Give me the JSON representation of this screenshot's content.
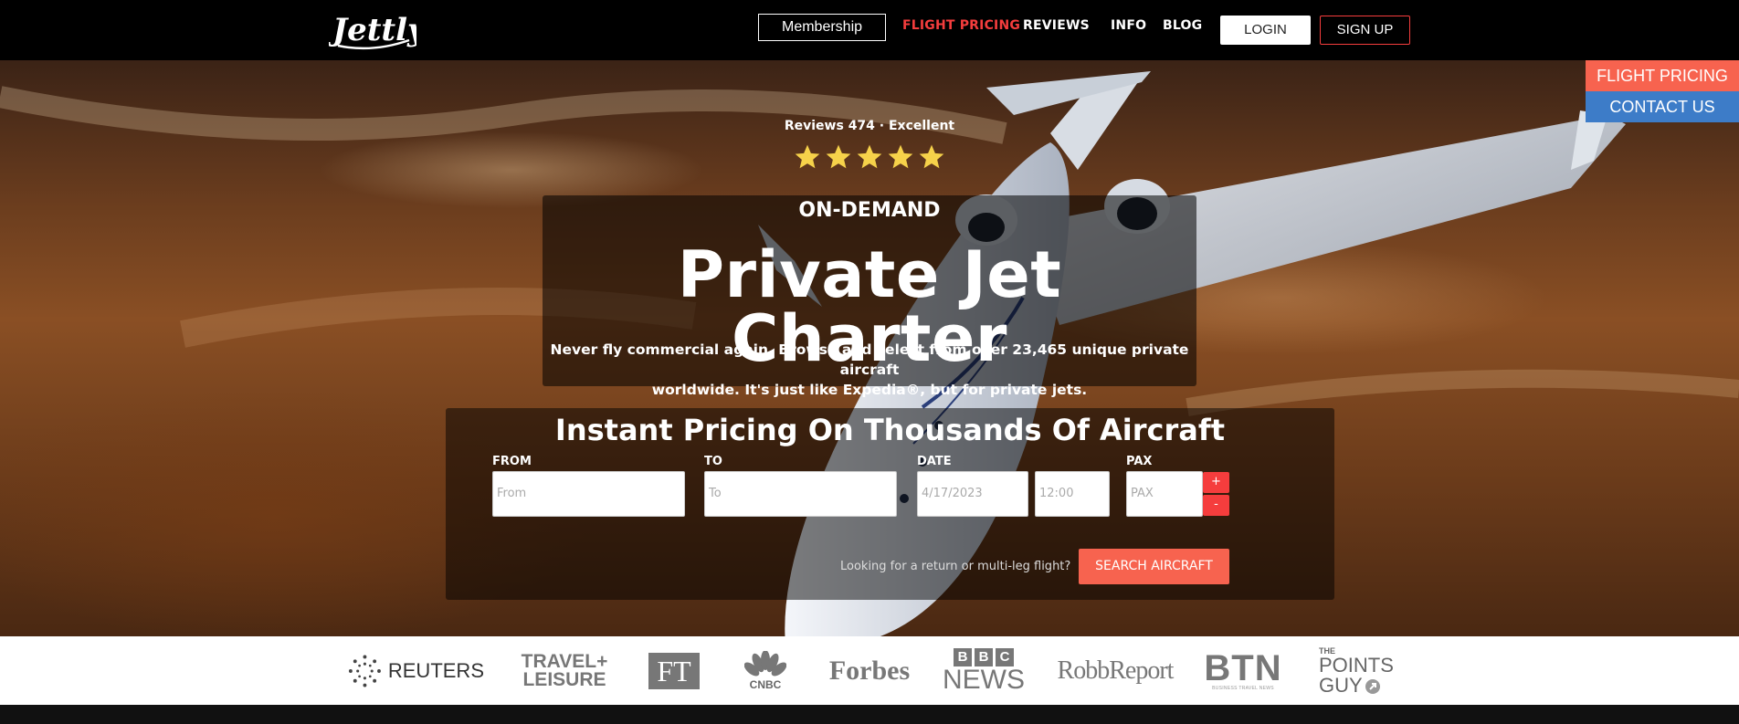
{
  "nav": {
    "logo_text": "Jettly",
    "membership": "Membership",
    "links": [
      "FLIGHT PRICING",
      "REVIEWS",
      "INFO",
      "BLOG"
    ],
    "login": "LOGIN",
    "signup": "SIGN UP"
  },
  "side_tabs": {
    "flight_pricing": "FLIGHT PRICING",
    "contact_us": "CONTACT US"
  },
  "hero": {
    "reviews": "Reviews 474 · Excellent",
    "rating_stars": 5,
    "eyebrow": "ON-DEMAND",
    "title": "Private Jet Charter",
    "subtitle_line1": "Never fly commercial again. Browse and select from over 23,465 unique private aircraft",
    "subtitle_line2": "worldwide. It's just like Expedia®, but for private jets."
  },
  "search": {
    "title": "Instant Pricing On Thousands Of Aircraft",
    "from_label": "FROM",
    "from_placeholder": "From",
    "to_label": "TO",
    "to_placeholder": "To",
    "date_label": "DATE",
    "date_value": "4/17/2023",
    "time_value": "12:00",
    "pax_label": "PAX",
    "pax_placeholder": "PAX",
    "pax_plus": "+",
    "pax_minus": "-",
    "multi_leg": "Looking for a return or multi-leg flight?",
    "button": "SEARCH AIRCRAFT"
  },
  "press": {
    "reuters": "REUTERS",
    "travel_leisure_1": "TRAVEL+",
    "travel_leisure_2": "LEISURE",
    "ft": "FT",
    "cnbc": "CNBC",
    "forbes": "Forbes",
    "bbc_b1": "B",
    "bbc_b2": "B",
    "bbc_c": "C",
    "bbc_news": "NEWS",
    "robb": "RobbReport",
    "btn": "BTN",
    "btn_sub": "BUSINESS TRAVEL NEWS",
    "tpg_the": "THE",
    "tpg_points": "POINTS",
    "tpg_guy": "GUY"
  },
  "colors": {
    "accent_red": "#f53d3d",
    "button_coral": "#f7634f",
    "contact_blue": "#3d7cc8"
  }
}
